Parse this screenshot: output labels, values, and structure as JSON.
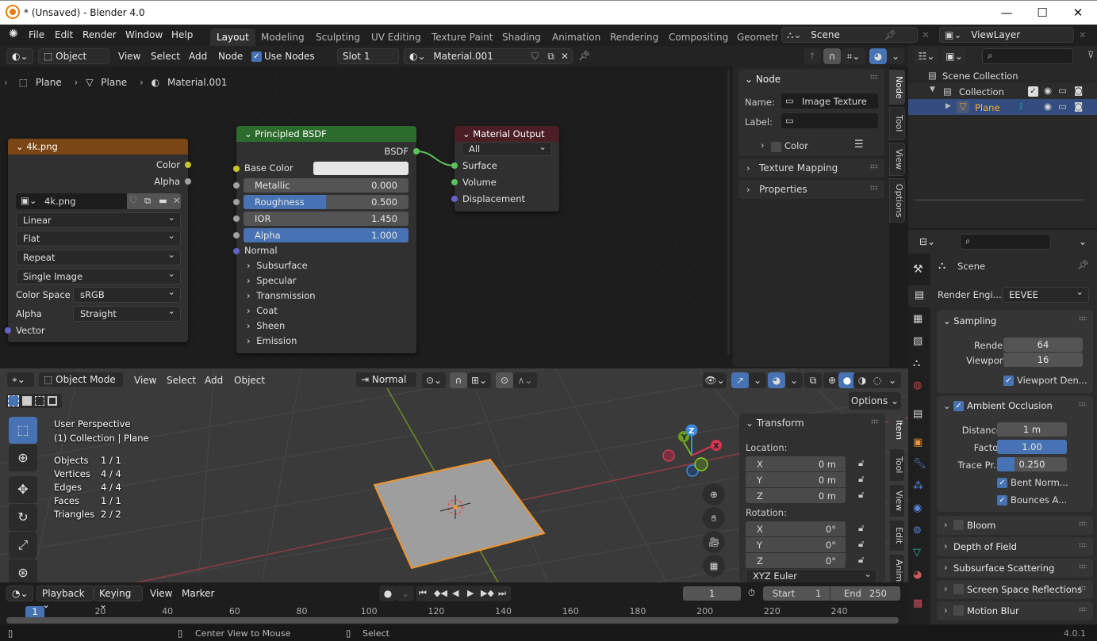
{
  "window": {
    "title": "* (Unsaved) - Blender 4.0",
    "min": "—",
    "max": "☐",
    "close": "✕"
  },
  "menu": [
    "File",
    "Edit",
    "Render",
    "Window",
    "Help"
  ],
  "workspaces": [
    "Layout",
    "Modeling",
    "Sculpting",
    "UV Editing",
    "Texture Paint",
    "Shading",
    "Animation",
    "Rendering",
    "Compositing",
    "Geometry"
  ],
  "active_workspace": "Layout",
  "scene_selector": {
    "value": "Scene"
  },
  "viewlayer_selector": {
    "value": "ViewLayer"
  },
  "node_header": {
    "mode": "Object",
    "menus": [
      "View",
      "Select",
      "Add",
      "Node"
    ],
    "use_nodes_label": "Use Nodes",
    "use_nodes_checked": true,
    "slot": "Slot 1",
    "material": "Material.001"
  },
  "breadcrumb": [
    "Plane",
    "Plane",
    "Material.001"
  ],
  "nodes": {
    "image_texture": {
      "title": "4k.png",
      "outputs": [
        "Color",
        "Alpha"
      ],
      "image": "4k.png",
      "interpolation": "Linear",
      "projection": "Flat",
      "extension": "Repeat",
      "source": "Single Image",
      "color_space_label": "Color Space",
      "color_space": "sRGB",
      "alpha_label": "Alpha",
      "alpha": "Straight",
      "input": "Vector"
    },
    "principled": {
      "title": "Principled BSDF",
      "output": "BSDF",
      "base_color_label": "Base Color",
      "base_color": "#e6e6e6",
      "sliders": [
        {
          "label": "Metallic",
          "value": "0.000",
          "fraction": 0.0
        },
        {
          "label": "Roughness",
          "value": "0.500",
          "fraction": 0.5
        },
        {
          "label": "IOR",
          "value": "1.450",
          "fraction": 0.0
        },
        {
          "label": "Alpha",
          "value": "1.000",
          "fraction": 1.0
        }
      ],
      "normal": "Normal",
      "panels": [
        "Subsurface",
        "Specular",
        "Transmission",
        "Coat",
        "Sheen",
        "Emission"
      ]
    },
    "output": {
      "title": "Material Output",
      "target": "All",
      "inputs": [
        "Surface",
        "Volume",
        "Displacement"
      ]
    }
  },
  "node_sidebar": {
    "section": "Node",
    "name_label": "Name:",
    "name_value": "Image Texture",
    "label_label": "Label:",
    "label_value": "",
    "color_label": "Color",
    "sections": [
      "Texture Mapping",
      "Properties"
    ],
    "tabs": [
      "Node",
      "Tool",
      "View",
      "Options"
    ]
  },
  "outliner": {
    "items": [
      {
        "label": "Scene Collection",
        "level": 0
      },
      {
        "label": "Collection",
        "level": 1
      },
      {
        "label": "Plane",
        "level": 2,
        "selected": true
      }
    ]
  },
  "properties": {
    "context": "Scene",
    "render_engine_label": "Render Engi...",
    "render_engine": "EEVEE",
    "sampling": {
      "title": "Sampling",
      "render_label": "Render",
      "render": "64",
      "viewport_label": "Viewport",
      "viewport": "16",
      "denoise_label": "Viewport Den...",
      "denoise": true
    },
    "ao": {
      "title": "Ambient Occlusion",
      "enabled": true,
      "distance_label": "Distance",
      "distance": "1 m",
      "factor_label": "Factor",
      "factor": "1.00",
      "factor_fraction": 1.0,
      "trace_label": "Trace Pr...",
      "trace": "0.250",
      "trace_fraction": 0.25,
      "bent_label": "Bent Norm...",
      "bent": true,
      "bounces_label": "Bounces A...",
      "bounces": true
    },
    "collapsed": [
      {
        "label": "Bloom",
        "checkbox": true
      },
      {
        "label": "Depth of Field",
        "checkbox": false
      },
      {
        "label": "Subsurface Scattering",
        "checkbox": false
      },
      {
        "label": "Screen Space Reflections",
        "checkbox": true
      },
      {
        "label": "Motion Blur",
        "checkbox": true
      }
    ]
  },
  "viewport": {
    "mode": "Object Mode",
    "menus": [
      "View",
      "Select",
      "Add",
      "Object"
    ],
    "orientation": "Normal",
    "options": "Options",
    "overlay_title": "User Perspective",
    "overlay_subtitle": "(1) Collection | Plane",
    "stats": [
      {
        "label": "Objects",
        "value": "1 / 1"
      },
      {
        "label": "Vertices",
        "value": "4 / 4"
      },
      {
        "label": "Edges",
        "value": "4 / 4"
      },
      {
        "label": "Faces",
        "value": "1 / 1"
      },
      {
        "label": "Triangles",
        "value": "2 / 2"
      }
    ],
    "gizmo": {
      "x": "X",
      "y": "Y",
      "z": "Z"
    },
    "transform": {
      "title": "Transform",
      "location_label": "Location:",
      "location": [
        {
          "axis": "X",
          "value": "0 m"
        },
        {
          "axis": "Y",
          "value": "0 m"
        },
        {
          "axis": "Z",
          "value": "0 m"
        }
      ],
      "rotation_label": "Rotation:",
      "rotation": [
        {
          "axis": "X",
          "value": "0°"
        },
        {
          "axis": "Y",
          "value": "0°"
        },
        {
          "axis": "Z",
          "value": "0°"
        }
      ],
      "rotation_mode": "XYZ Euler"
    },
    "tabs": [
      "Item",
      "Tool",
      "View",
      "Edit",
      "Anim"
    ]
  },
  "timeline": {
    "menus": [
      "Playback",
      "Keying",
      "View",
      "Marker"
    ],
    "current_frame": "1",
    "start_label": "Start",
    "start": "1",
    "end_label": "End",
    "end": "250",
    "ticks": [
      "20",
      "40",
      "60",
      "80",
      "100",
      "120",
      "140",
      "160",
      "180",
      "200",
      "220",
      "240"
    ],
    "playhead": "1"
  },
  "statusbar": {
    "hint_middle": "Center View to Mouse",
    "hint_right": "Select",
    "version": "4.0.1"
  }
}
